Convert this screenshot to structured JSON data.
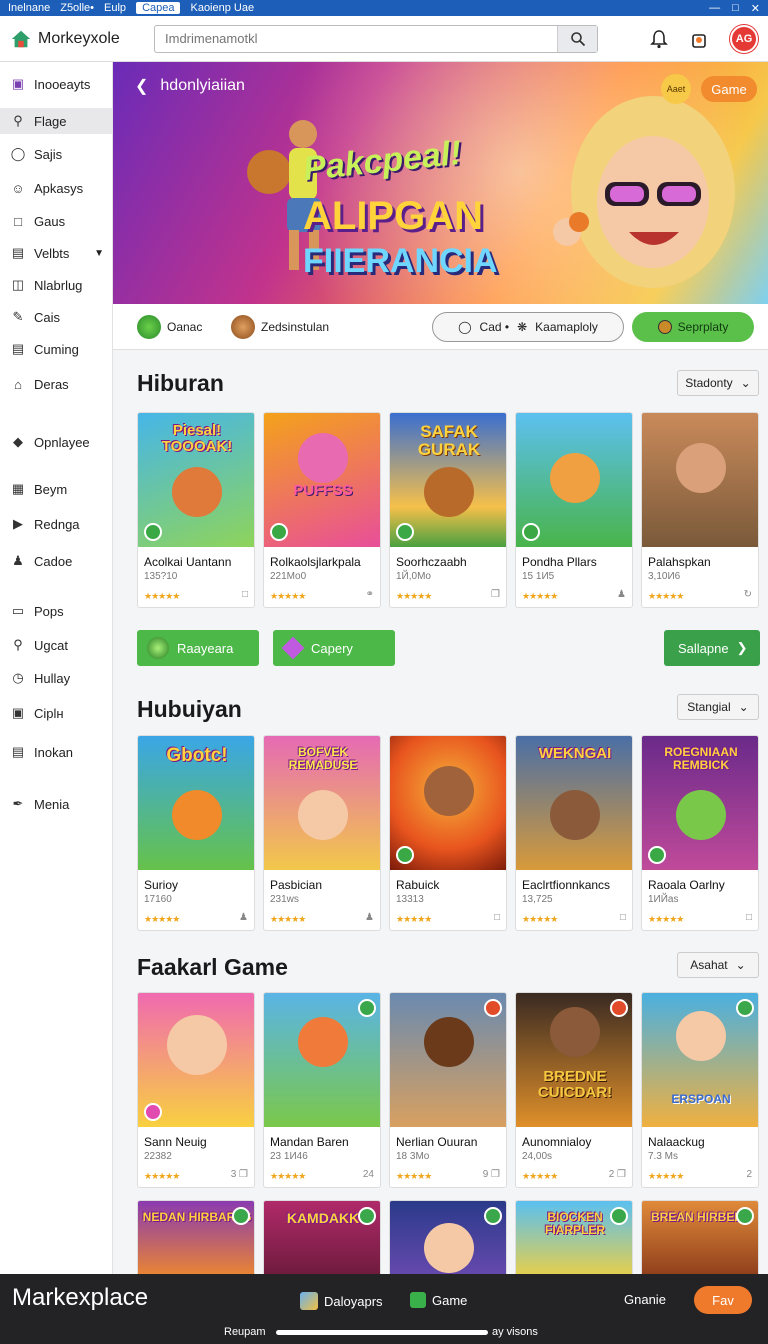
{
  "statusbar": {
    "items": [
      "Inelnane",
      "Z5olle•",
      "Eulp",
      "Capea",
      "Kaoienp Uae"
    ]
  },
  "app": {
    "logo": "Morkeyxole",
    "search_placeholder": "Imdrimenamotkl",
    "avatar": "AG"
  },
  "sidebar": {
    "items": [
      {
        "label": "Inooeayts",
        "icon": "grid-icon"
      },
      {
        "label": "Flage",
        "icon": "search-icon"
      },
      {
        "label": "Sajis",
        "icon": "chat-icon"
      },
      {
        "label": "Apkasys",
        "icon": "user-icon"
      },
      {
        "label": "Gaus",
        "icon": "square-icon"
      },
      {
        "label": "Velbts",
        "icon": "list-icon"
      },
      {
        "label": "Nlabrlug",
        "icon": "car-icon"
      },
      {
        "label": "Cais",
        "icon": "edit-icon"
      },
      {
        "label": "Cuming",
        "icon": "doc-icon"
      },
      {
        "label": "Deras",
        "icon": "home-icon"
      },
      {
        "label": "Opnlayee",
        "icon": "tag-icon"
      },
      {
        "label": "Beym",
        "icon": "calendar-icon"
      },
      {
        "label": "Redngа",
        "icon": "play-icon"
      },
      {
        "label": "Cadoe",
        "icon": "people-icon"
      },
      {
        "label": "Pops",
        "icon": "folder-icon"
      },
      {
        "label": "Ugcat",
        "icon": "search-icon"
      },
      {
        "label": "Hullay",
        "icon": "clock-icon"
      },
      {
        "label": "Ciplн",
        "icon": "lock-icon"
      },
      {
        "label": "Inokan",
        "icon": "doc-icon"
      },
      {
        "label": "Menia",
        "icon": "pen-icon"
      }
    ]
  },
  "hero": {
    "back_label": "hdonlyiaiian",
    "line1": "Pakcpeal!",
    "line2": "ALIPGAN",
    "line3": "FIIERANCIA",
    "pill_small": "Aaet",
    "pill_game": "Game"
  },
  "chips": {
    "c1": "Oanac",
    "c2": "Zedsinstulan",
    "c3a": "Cad •",
    "c3b": "Kaamaploly",
    "c4": "Seprplaty"
  },
  "section1": {
    "title": "Hiburan",
    "sort": "Stadonty",
    "cards": [
      {
        "title": "Acolkai Uantann",
        "meta": "135?10",
        "art": "Piesal! TOOOAK!",
        "c1": "#46b6e8",
        "c2": "#8fd45a"
      },
      {
        "title": "Rolkaolsjlarkpala",
        "meta": "221Mo0",
        "art": "PUFFSS",
        "c1": "#f4a21a",
        "c2": "#e84e9a"
      },
      {
        "title": "Soorhczaabh",
        "meta": "1Й,0Mo",
        "art": "SAFAK GURAK",
        "c1": "#3a6ed0",
        "c2": "#f6c04a"
      },
      {
        "title": "Pondha Pllars",
        "meta": "15 1И5",
        "art": "",
        "c1": "#5cc0f0",
        "c2": "#49b44a"
      },
      {
        "title": "Palahspkan",
        "meta": "3,10И6",
        "art": "",
        "c1": "#c98a5a",
        "c2": "#7a5a3a"
      }
    ],
    "btn_left": "Raayeara",
    "btn_mid": "Capery",
    "btn_right": "Sallapne"
  },
  "section2": {
    "title": "Hubuiyan",
    "sort": "Stangial",
    "cards": [
      {
        "title": "Suriоy",
        "meta": "17160",
        "art": "Gbotc!",
        "c1": "#3aa6e6",
        "c2": "#66c24a"
      },
      {
        "title": "Pasbician",
        "meta": "231ws",
        "art": "BOFVEK REMADUSE",
        "c1": "#e56ab4",
        "c2": "#f2c84a"
      },
      {
        "title": "Rabuick",
        "meta": "13313",
        "art": "",
        "c1": "#e8541e",
        "c2": "#f6b23a"
      },
      {
        "title": "Eaclrtfionnkancs",
        "meta": "13,725",
        "art": "WEKNGAI",
        "c1": "#4a6fa6",
        "c2": "#d89a3a"
      },
      {
        "title": "Raoala Oarlny",
        "meta": "1ИЙas",
        "art": "ROEGNIAAN REMBICK",
        "c1": "#6a2a8a",
        "c2": "#f0c03a"
      }
    ]
  },
  "section3": {
    "title": "Faakarl Game",
    "sort": "Asahat",
    "cards": [
      {
        "title": "Sann Neuig",
        "meta": "22382",
        "art": "",
        "c1": "#f06ab0",
        "c2": "#f8d040"
      },
      {
        "title": "Mandan Baren",
        "meta": "23 1И46",
        "art": "",
        "c1": "#5ab4e6",
        "c2": "#7ac84a"
      },
      {
        "title": "Nerlian Ouuran",
        "meta": "18 3Mo",
        "art": "",
        "c1": "#6a8ab0",
        "c2": "#d8a060"
      },
      {
        "title": "Aunomnialoy",
        "meta": "24,00s",
        "art": "BREDNE CUICDAR!",
        "c1": "#3a2a22",
        "c2": "#e0902a"
      },
      {
        "title": "Nalaackug",
        "meta": "7.3 Ms",
        "art": "ERSPOAN",
        "c1": "#4ab0e0",
        "c2": "#f0b040"
      }
    ],
    "row2_art": [
      "NEDAN HIRBARES",
      "KAMDAKK",
      "",
      "BIOCKEN FIARPLER",
      "BREAN HIRBERS"
    ]
  },
  "bottom": {
    "brand": "Markexplace",
    "b1": "Daloyaprs",
    "b2": "Game",
    "b3": "Gnanie",
    "b4": "Fav",
    "lbl_l": "Reupam",
    "lbl_r": "ay visons"
  }
}
